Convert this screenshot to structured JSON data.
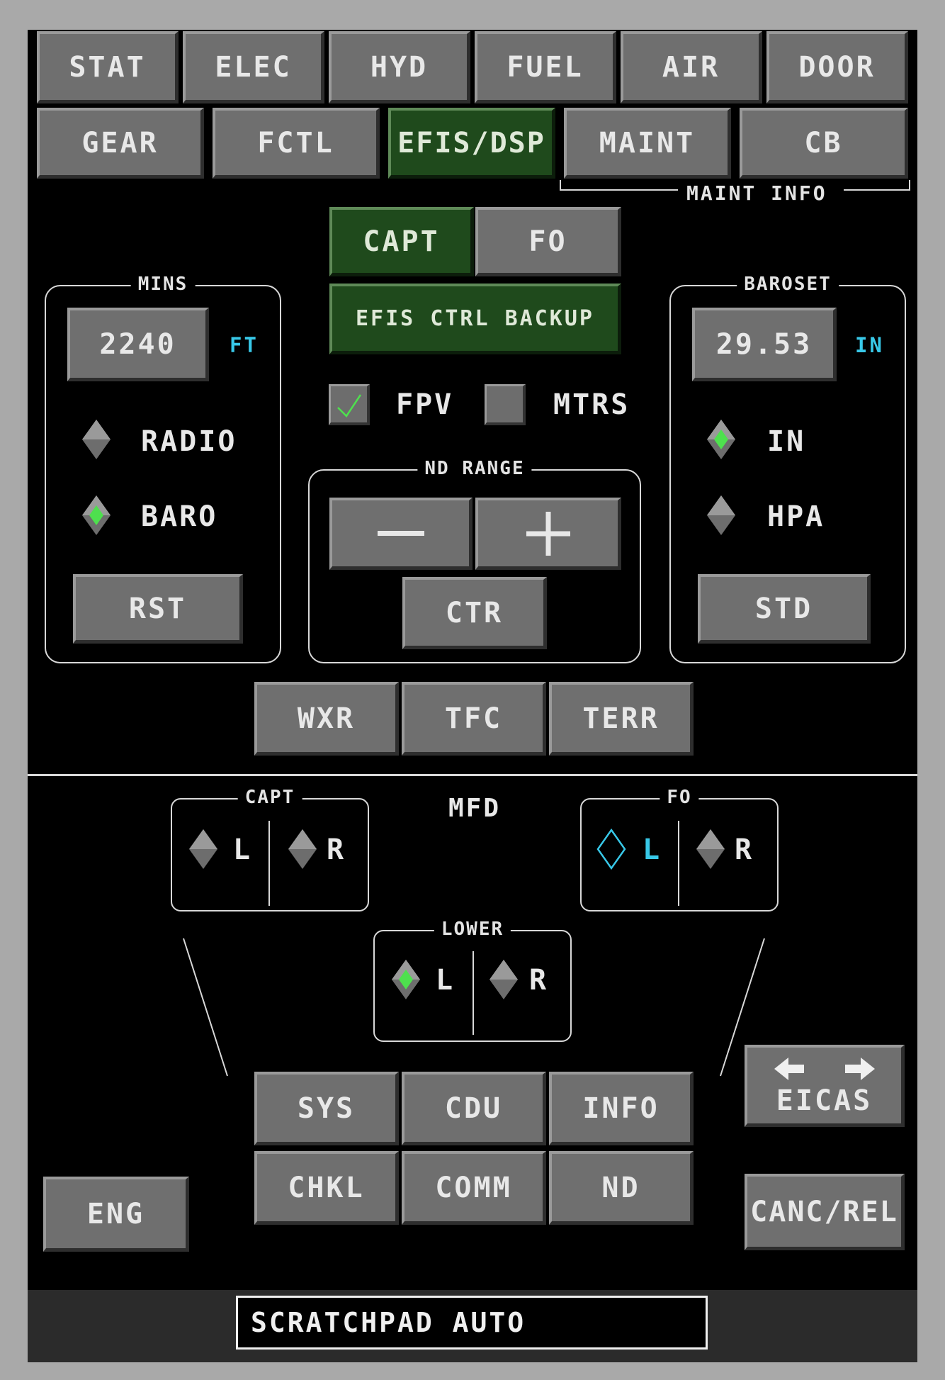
{
  "top_tabs_row1": [
    "STAT",
    "ELEC",
    "HYD",
    "FUEL",
    "AIR",
    "DOOR"
  ],
  "top_tabs_row2": [
    "GEAR",
    "FCTL",
    "EFIS/DSP",
    "MAINT",
    "CB"
  ],
  "maint_info_label": "MAINT INFO",
  "efis": {
    "capt_label": "CAPT",
    "fo_label": "FO",
    "backup_label": "EFIS CTRL BACKUP",
    "fpv_label": "FPV",
    "mtrs_label": "MTRS",
    "fpv_checked": true,
    "mtrs_checked": false
  },
  "mins": {
    "title": "MINS",
    "value": "2240",
    "unit": "FT",
    "radio_label": "RADIO",
    "baro_label": "BARO",
    "selected": "BARO",
    "rst_label": "RST"
  },
  "baroset": {
    "title": "BAROSET",
    "value": "29.53",
    "unit": "IN",
    "in_label": "IN",
    "hpa_label": "HPA",
    "selected": "IN",
    "std_label": "STD"
  },
  "nd_range": {
    "title": "ND RANGE",
    "minus_label": "—",
    "plus_label": "+",
    "ctr_label": "CTR"
  },
  "overlays": [
    "WXR",
    "TFC",
    "TERR"
  ],
  "mfd": {
    "title": "MFD",
    "capt": {
      "title": "CAPT",
      "l": "L",
      "r": "R",
      "selected": "none"
    },
    "fo": {
      "title": "FO",
      "l": "L",
      "r": "R",
      "selected": "L-outline"
    },
    "lower": {
      "title": "LOWER",
      "l": "L",
      "r": "R",
      "selected": "L"
    }
  },
  "mfd_keys_row1": [
    "SYS",
    "CDU",
    "INFO"
  ],
  "mfd_keys_row2": [
    "CHKL",
    "COMM",
    "ND"
  ],
  "eng_label": "ENG",
  "eicas_label": "EICAS",
  "canc_rel_label": "CANC/REL",
  "scratchpad": "SCRATCHPAD AUTO",
  "colors": {
    "panel": "#000000",
    "button": "#6f6f6f",
    "active": "#1f4a1c",
    "cyan": "#38c8e8",
    "green_light": "#4ee04e"
  }
}
